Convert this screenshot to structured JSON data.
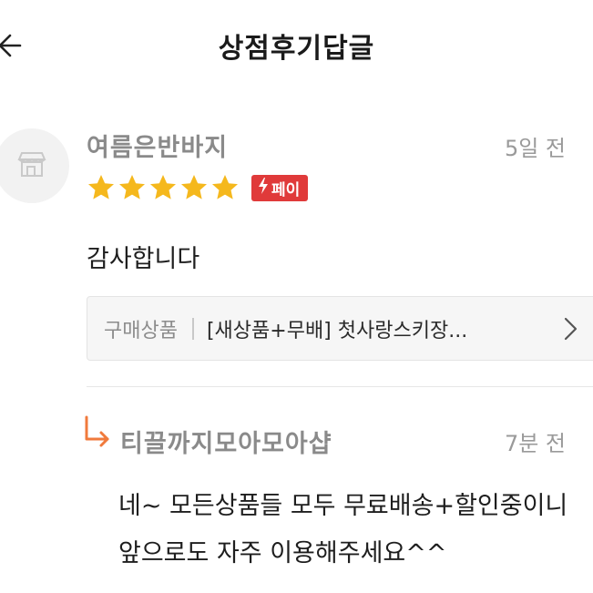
{
  "header": {
    "title": "상점후기답글",
    "back_icon": "back-arrow-icon"
  },
  "review": {
    "avatar_icon": "shop-icon",
    "reviewer_name": "여름은반바지",
    "time": "5일 전",
    "rating": 5,
    "rating_max": 5,
    "star_color": "#f5b81d",
    "pay_badge": {
      "icon": "lightning-icon",
      "label": "페이",
      "color": "#e03a3a"
    },
    "text": "감사합니다",
    "product": {
      "label": "구매상품",
      "name": "[새상품+무배] 첫사랑스키장...",
      "chevron_icon": "chevron-right-icon"
    }
  },
  "reply": {
    "arrow_icon": "reply-arrow-icon",
    "arrow_color": "#f07a3c",
    "seller_name": "티끌까지모아모아샵",
    "time": "7분 전",
    "lines": [
      "네~ 모든상품들 모두 무료배송+할인중이니",
      "앞으로도 자주 이용해주세요^^"
    ]
  }
}
